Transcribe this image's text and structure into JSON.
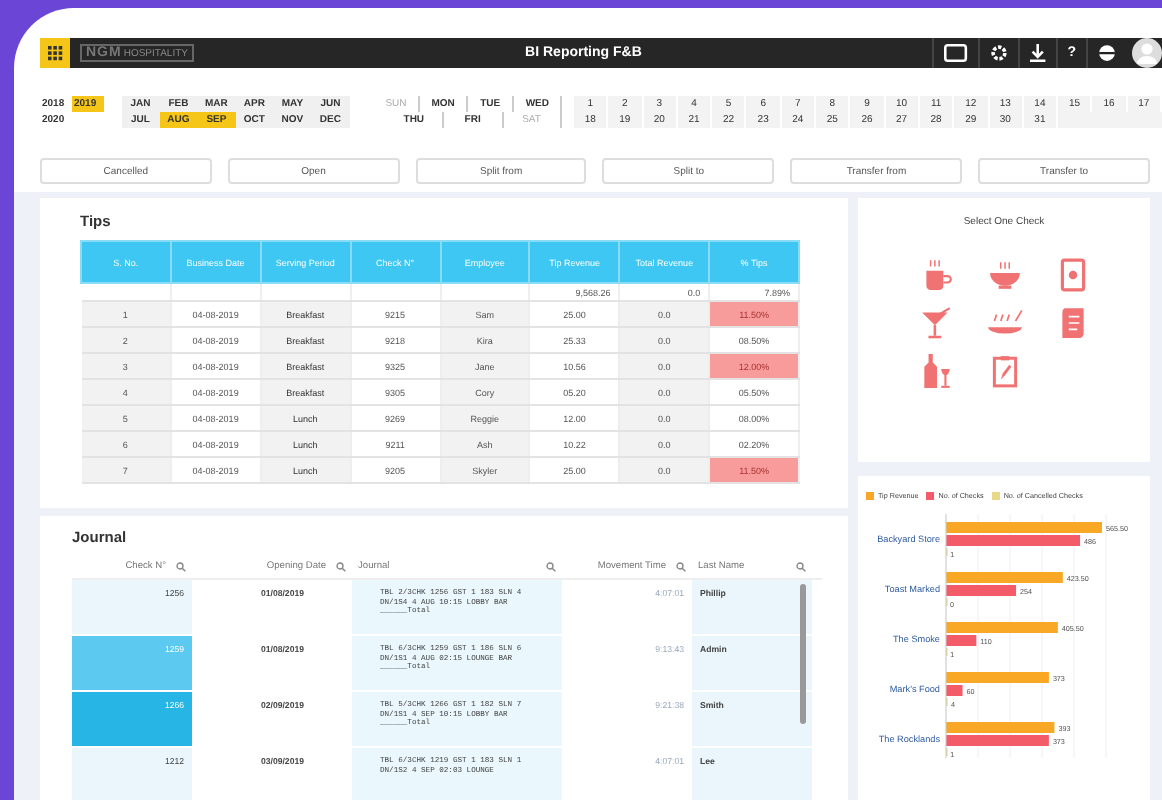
{
  "header": {
    "logo_mark": "NGM",
    "logo_text": "HOSPITALITY",
    "title": "BI Reporting F&B",
    "help_glyph": "?"
  },
  "filters": {
    "years": [
      {
        "label": "2018",
        "selected": false
      },
      {
        "label": "2019",
        "selected": true
      },
      {
        "label": "2020",
        "selected": false
      }
    ],
    "months": [
      {
        "label": "JAN",
        "selected": false
      },
      {
        "label": "FEB",
        "selected": false
      },
      {
        "label": "MAR",
        "selected": false
      },
      {
        "label": "APR",
        "selected": false
      },
      {
        "label": "MAY",
        "selected": false
      },
      {
        "label": "JUN",
        "selected": false
      },
      {
        "label": "JUL",
        "selected": false
      },
      {
        "label": "AUG",
        "selected": true
      },
      {
        "label": "SEP",
        "selected": true
      },
      {
        "label": "OCT",
        "selected": false
      },
      {
        "label": "NOV",
        "selected": false
      },
      {
        "label": "DEC",
        "selected": false
      }
    ],
    "weekdays": [
      {
        "label": "SUN",
        "disabled": true
      },
      {
        "label": "MON",
        "disabled": false
      },
      {
        "label": "TUE",
        "disabled": false
      },
      {
        "label": "WED",
        "disabled": false
      },
      {
        "label": "THU",
        "disabled": false
      },
      {
        "label": "FRI",
        "disabled": false
      },
      {
        "label": "SAT",
        "disabled": true
      }
    ],
    "days": [
      "1",
      "2",
      "3",
      "4",
      "5",
      "6",
      "7",
      "8",
      "9",
      "10",
      "11",
      "12",
      "13",
      "14",
      "15",
      "16",
      "17",
      "18",
      "19",
      "20",
      "21",
      "22",
      "23",
      "24",
      "25",
      "26",
      "27",
      "28",
      "29",
      "30",
      "31"
    ]
  },
  "status_buttons": [
    "Cancelled",
    "Open",
    "Split from",
    "Split to",
    "Transfer from",
    "Transfer to"
  ],
  "tips": {
    "title": "Tips",
    "columns": [
      "S. No.",
      "Business Date",
      "Serving Period",
      "Check N°",
      "Employee",
      "Tip Revenue",
      "Total Revenue",
      "% Tips"
    ],
    "totals": {
      "tip_revenue": "9,568.26",
      "total_revenue": "0.0",
      "tips_percent": "7.89%"
    },
    "rows": [
      {
        "cells": [
          "1",
          "04-08-2019",
          "Breakfast",
          "9215",
          "Sam",
          "25.00",
          "0.0",
          "11.50%"
        ],
        "flagged": true
      },
      {
        "cells": [
          "2",
          "04-08-2019",
          "Breakfast",
          "9218",
          "Kira",
          "25.33",
          "0.0",
          "08.50%"
        ],
        "flagged": false
      },
      {
        "cells": [
          "3",
          "04-08-2019",
          "Breakfast",
          "9325",
          "Jane",
          "10.56",
          "0.0",
          "12.00%"
        ],
        "flagged": true
      },
      {
        "cells": [
          "4",
          "04-08-2019",
          "Breakfast",
          "9305",
          "Cory",
          "05.20",
          "0.0",
          "05.50%"
        ],
        "flagged": false
      },
      {
        "cells": [
          "5",
          "04-08-2019",
          "Lunch",
          "9269",
          "Reggie",
          "12.00",
          "0.0",
          "08.00%"
        ],
        "flagged": false
      },
      {
        "cells": [
          "6",
          "04-08-2019",
          "Lunch",
          "9211",
          "Ash",
          "10.22",
          "0.0",
          "02.20%"
        ],
        "flagged": false
      },
      {
        "cells": [
          "7",
          "04-08-2019",
          "Lunch",
          "9205",
          "Skyler",
          "25.00",
          "0.0",
          "11.50%"
        ],
        "flagged": true
      }
    ]
  },
  "check_picker": {
    "title": "Select One Check",
    "icons": [
      {
        "kind": "mug"
      },
      {
        "kind": "cup"
      },
      {
        "kind": "card"
      },
      {
        "kind": "cocktail"
      },
      {
        "kind": "plate"
      },
      {
        "kind": "scroll"
      },
      {
        "kind": "bottle"
      },
      {
        "kind": "clipboard"
      }
    ]
  },
  "journal": {
    "title": "Journal",
    "columns": [
      "Check N°",
      "Opening Date",
      "Journal",
      "Movement Time",
      "Last Name"
    ],
    "rows": [
      {
        "check": "1256",
        "opening_date": "01/08/2019",
        "journal": "TBL 2/3CHK 1256 GST 1 183 SLN 4 DN/1S4 4 AUG 10:15 LOBBY BAR ______Total",
        "time": "4:07:01",
        "last_name": "Phillip",
        "selected": false
      },
      {
        "check": "1259",
        "opening_date": "01/08/2019",
        "journal": "TBL 6/3CHK 1259 GST 1 186 SLN 6 DN/1S1 4 AUG 02:15 LOUNGE BAR ______Total",
        "time": "9:13:43",
        "last_name": "Admin",
        "selected": true,
        "color": "#5cc9f0"
      },
      {
        "check": "1266",
        "opening_date": "02/09/2019",
        "journal": "TBL 5/3CHK 1266 GST 1 182 SLN 7 DN/1S1 4 SEP 10:15 LOBBY BAR ______Total",
        "time": "9:21:38",
        "last_name": "Smith",
        "selected": true,
        "color": "#27b5e6"
      },
      {
        "check": "1212",
        "opening_date": "03/09/2019",
        "journal": "TBL 6/3CHK 1219 GST 1 183 SLN 1 DN/1S2 4 SEP 02:03 LOUNGE",
        "time": "4:07:01",
        "last_name": "Lee",
        "selected": false
      }
    ]
  },
  "chart": {
    "chart_data": {
      "type": "bar",
      "orientation": "horizontal",
      "categories": [
        "Backyard Store",
        "Toast Marked",
        "The Smoke",
        "Mark's Food",
        "The Rocklands"
      ],
      "series": [
        {
          "name": "Tip Revenue",
          "color": "#f9a825",
          "values": [
            565.5,
            423.5,
            405.5,
            373,
            393
          ],
          "value_labels": [
            "565.50",
            "423.50",
            "405.50",
            "373",
            "393"
          ]
        },
        {
          "name": "No. of Checks",
          "color": "#f45b69",
          "values": [
            486,
            254,
            110,
            60,
            373
          ]
        },
        {
          "name": "No. of Cancelled Checks",
          "color": "#e8d98a",
          "values": [
            1,
            0,
            1,
            4,
            1
          ]
        }
      ],
      "data_labels": true
    }
  }
}
